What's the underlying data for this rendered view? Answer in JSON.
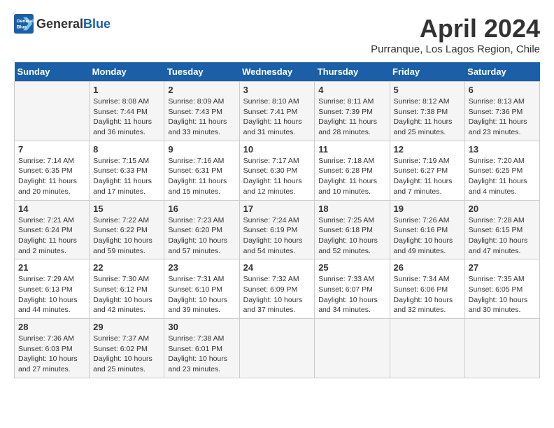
{
  "header": {
    "logo_line1": "General",
    "logo_line2": "Blue",
    "month_title": "April 2024",
    "subtitle": "Purranque, Los Lagos Region, Chile"
  },
  "days_of_week": [
    "Sunday",
    "Monday",
    "Tuesday",
    "Wednesday",
    "Thursday",
    "Friday",
    "Saturday"
  ],
  "weeks": [
    [
      {
        "day": "",
        "info": ""
      },
      {
        "day": "1",
        "info": "Sunrise: 8:08 AM\nSunset: 7:44 PM\nDaylight: 11 hours\nand 36 minutes."
      },
      {
        "day": "2",
        "info": "Sunrise: 8:09 AM\nSunset: 7:43 PM\nDaylight: 11 hours\nand 33 minutes."
      },
      {
        "day": "3",
        "info": "Sunrise: 8:10 AM\nSunset: 7:41 PM\nDaylight: 11 hours\nand 31 minutes."
      },
      {
        "day": "4",
        "info": "Sunrise: 8:11 AM\nSunset: 7:39 PM\nDaylight: 11 hours\nand 28 minutes."
      },
      {
        "day": "5",
        "info": "Sunrise: 8:12 AM\nSunset: 7:38 PM\nDaylight: 11 hours\nand 25 minutes."
      },
      {
        "day": "6",
        "info": "Sunrise: 8:13 AM\nSunset: 7:36 PM\nDaylight: 11 hours\nand 23 minutes."
      }
    ],
    [
      {
        "day": "7",
        "info": "Sunrise: 7:14 AM\nSunset: 6:35 PM\nDaylight: 11 hours\nand 20 minutes."
      },
      {
        "day": "8",
        "info": "Sunrise: 7:15 AM\nSunset: 6:33 PM\nDaylight: 11 hours\nand 17 minutes."
      },
      {
        "day": "9",
        "info": "Sunrise: 7:16 AM\nSunset: 6:31 PM\nDaylight: 11 hours\nand 15 minutes."
      },
      {
        "day": "10",
        "info": "Sunrise: 7:17 AM\nSunset: 6:30 PM\nDaylight: 11 hours\nand 12 minutes."
      },
      {
        "day": "11",
        "info": "Sunrise: 7:18 AM\nSunset: 6:28 PM\nDaylight: 11 hours\nand 10 minutes."
      },
      {
        "day": "12",
        "info": "Sunrise: 7:19 AM\nSunset: 6:27 PM\nDaylight: 11 hours\nand 7 minutes."
      },
      {
        "day": "13",
        "info": "Sunrise: 7:20 AM\nSunset: 6:25 PM\nDaylight: 11 hours\nand 4 minutes."
      }
    ],
    [
      {
        "day": "14",
        "info": "Sunrise: 7:21 AM\nSunset: 6:24 PM\nDaylight: 11 hours\nand 2 minutes."
      },
      {
        "day": "15",
        "info": "Sunrise: 7:22 AM\nSunset: 6:22 PM\nDaylight: 10 hours\nand 59 minutes."
      },
      {
        "day": "16",
        "info": "Sunrise: 7:23 AM\nSunset: 6:20 PM\nDaylight: 10 hours\nand 57 minutes."
      },
      {
        "day": "17",
        "info": "Sunrise: 7:24 AM\nSunset: 6:19 PM\nDaylight: 10 hours\nand 54 minutes."
      },
      {
        "day": "18",
        "info": "Sunrise: 7:25 AM\nSunset: 6:18 PM\nDaylight: 10 hours\nand 52 minutes."
      },
      {
        "day": "19",
        "info": "Sunrise: 7:26 AM\nSunset: 6:16 PM\nDaylight: 10 hours\nand 49 minutes."
      },
      {
        "day": "20",
        "info": "Sunrise: 7:28 AM\nSunset: 6:15 PM\nDaylight: 10 hours\nand 47 minutes."
      }
    ],
    [
      {
        "day": "21",
        "info": "Sunrise: 7:29 AM\nSunset: 6:13 PM\nDaylight: 10 hours\nand 44 minutes."
      },
      {
        "day": "22",
        "info": "Sunrise: 7:30 AM\nSunset: 6:12 PM\nDaylight: 10 hours\nand 42 minutes."
      },
      {
        "day": "23",
        "info": "Sunrise: 7:31 AM\nSunset: 6:10 PM\nDaylight: 10 hours\nand 39 minutes."
      },
      {
        "day": "24",
        "info": "Sunrise: 7:32 AM\nSunset: 6:09 PM\nDaylight: 10 hours\nand 37 minutes."
      },
      {
        "day": "25",
        "info": "Sunrise: 7:33 AM\nSunset: 6:07 PM\nDaylight: 10 hours\nand 34 minutes."
      },
      {
        "day": "26",
        "info": "Sunrise: 7:34 AM\nSunset: 6:06 PM\nDaylight: 10 hours\nand 32 minutes."
      },
      {
        "day": "27",
        "info": "Sunrise: 7:35 AM\nSunset: 6:05 PM\nDaylight: 10 hours\nand 30 minutes."
      }
    ],
    [
      {
        "day": "28",
        "info": "Sunrise: 7:36 AM\nSunset: 6:03 PM\nDaylight: 10 hours\nand 27 minutes."
      },
      {
        "day": "29",
        "info": "Sunrise: 7:37 AM\nSunset: 6:02 PM\nDaylight: 10 hours\nand 25 minutes."
      },
      {
        "day": "30",
        "info": "Sunrise: 7:38 AM\nSunset: 6:01 PM\nDaylight: 10 hours\nand 23 minutes."
      },
      {
        "day": "",
        "info": ""
      },
      {
        "day": "",
        "info": ""
      },
      {
        "day": "",
        "info": ""
      },
      {
        "day": "",
        "info": ""
      }
    ]
  ]
}
